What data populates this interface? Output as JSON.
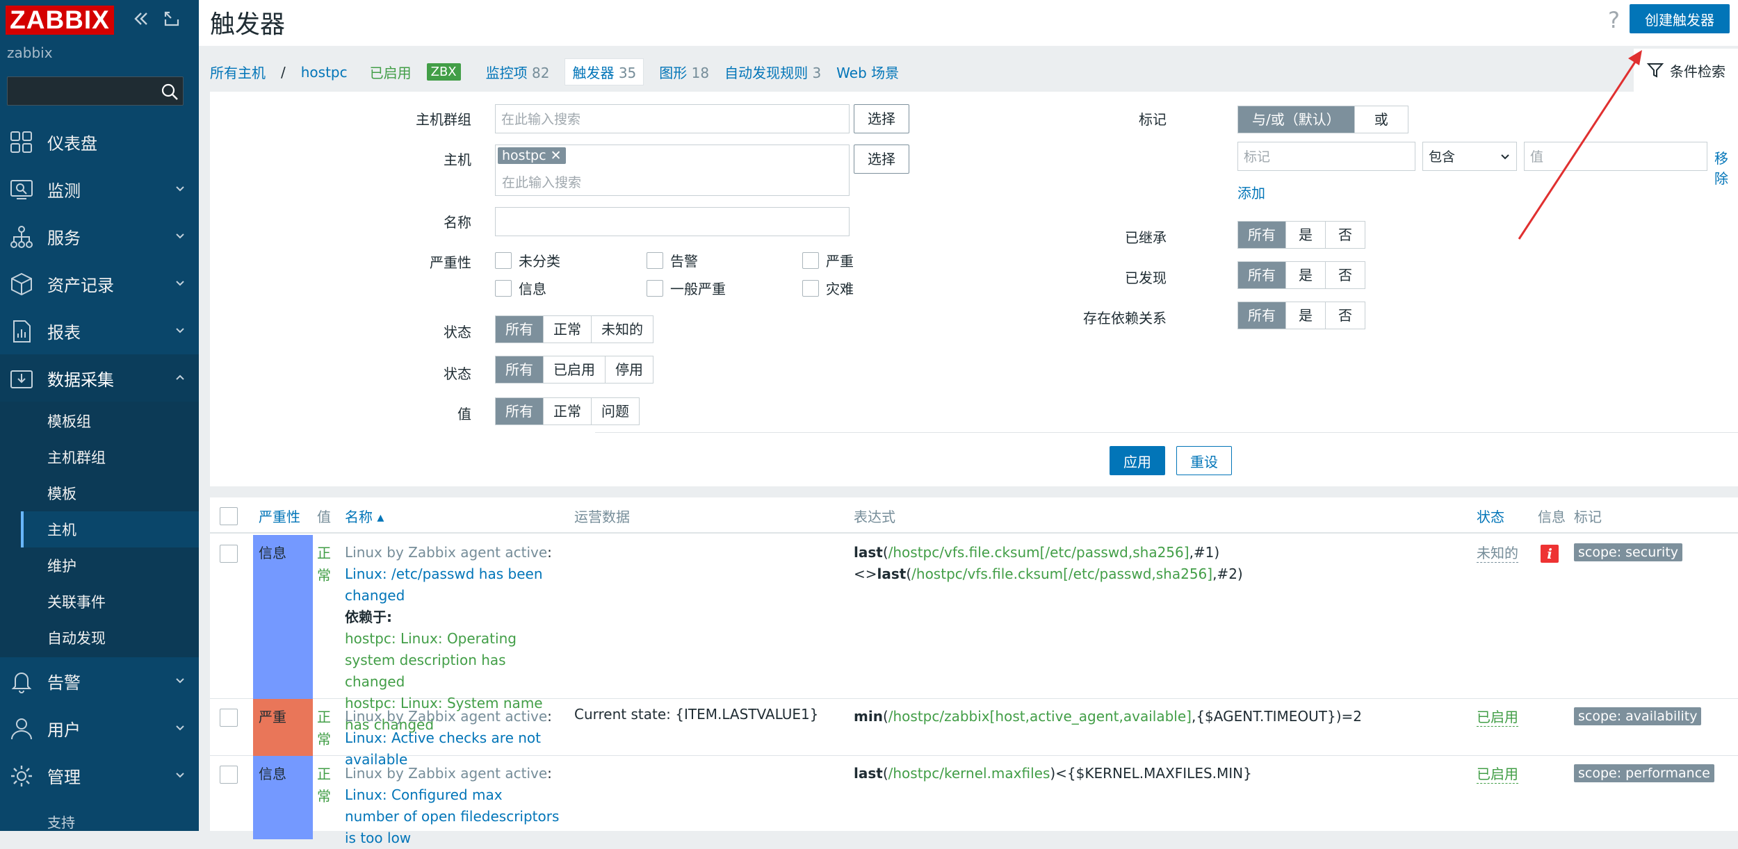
{
  "sidebar": {
    "logo": "ZABBIX",
    "subtitle": "zabbix",
    "search_placeholder": "",
    "menu": [
      {
        "label": "仪表盘",
        "icon": "dashboard-icon"
      },
      {
        "label": "监测",
        "icon": "monitoring-icon"
      },
      {
        "label": "服务",
        "icon": "services-icon"
      },
      {
        "label": "资产记录",
        "icon": "inventory-icon"
      },
      {
        "label": "报表",
        "icon": "reports-icon"
      },
      {
        "label": "数据采集",
        "icon": "data-collection-icon"
      },
      {
        "label": "告警",
        "icon": "alerts-icon"
      },
      {
        "label": "用户",
        "icon": "users-icon"
      },
      {
        "label": "管理",
        "icon": "admin-icon"
      }
    ],
    "submenu": [
      "模板组",
      "主机群组",
      "模板",
      "主机",
      "维护",
      "关联事件",
      "自动发现"
    ],
    "bottom_partial": "支持"
  },
  "header": {
    "title": "触发器",
    "help": "?",
    "create_button": "创建触发器"
  },
  "nav": {
    "all_hosts": "所有主机",
    "sep": "/",
    "host": "hostpc",
    "enabled": "已启用",
    "zbx": "ZBX",
    "items": "监控项",
    "items_count": "82",
    "triggers": "触发器",
    "triggers_count": "35",
    "graphs": "图形",
    "graphs_count": "18",
    "discovery": "自动发现规则",
    "discovery_count": "3",
    "web": "Web 场景",
    "filter_tab": "条件检索"
  },
  "filter": {
    "host_group_label": "主机群组",
    "host_group_placeholder": "在此输入搜索",
    "select": "选择",
    "host_label": "主机",
    "host_chip": "hostpc",
    "host_placeholder": "在此输入搜索",
    "name_label": "名称",
    "severity_label": "严重性",
    "severities": [
      "未分类",
      "告警",
      "严重",
      "信息",
      "一般严重",
      "灾难"
    ],
    "state_label": "状态",
    "state_opts": [
      "所有",
      "正常",
      "未知的"
    ],
    "status_label": "状态",
    "status_opts": [
      "所有",
      "已启用",
      "停用"
    ],
    "value_label": "值",
    "value_opts": [
      "所有",
      "正常",
      "问题"
    ],
    "tags_label": "标记",
    "tags_opts": [
      "与/或（默认）",
      "或"
    ],
    "tag_placeholder": "标记",
    "tag_op": "包含",
    "tag_value_placeholder": "值",
    "remove": "移除",
    "add": "添加",
    "inherited_label": "已继承",
    "discovered_label": "已发现",
    "depends_label": "存在依赖关系",
    "tri_opts": [
      "所有",
      "是",
      "否"
    ],
    "apply": "应用",
    "reset": "重设"
  },
  "table": {
    "headers": {
      "severity": "严重性",
      "value": "值",
      "name": "名称 ▴",
      "opdata": "运营数据",
      "expression": "表达式",
      "status": "状态",
      "info": "信息",
      "tags": "标记"
    },
    "rows": [
      {
        "severity": "信息",
        "sev_color": "#7499ff",
        "value": "正常",
        "template": "Linux by Zabbix agent active",
        "colon": ": ",
        "name": "Linux: /etc/passwd has been changed",
        "depends": "依赖于:",
        "dep1": "hostpc: Linux: Operating system description has changed",
        "dep2": "hostpc: Linux: System name has changed",
        "opdata": "",
        "ex1_fn": "last",
        "ex1_item": "/hostpc/vfs.file.cksum[/etc/passwd,sha256]",
        "ex1_tail": ",#1)",
        "ex2_pre": "<>",
        "ex2_fn": "last",
        "ex2_item": "/hostpc/vfs.file.cksum[/etc/passwd,sha256]",
        "ex2_tail": ",#2)",
        "status": "未知的",
        "info": "i",
        "tag": "scope: security"
      },
      {
        "severity": "严重",
        "sev_color": "#e97659",
        "value": "正常",
        "template": "Linux by Zabbix agent active",
        "colon": ": ",
        "name": "Linux: Active checks are not available",
        "opdata": "Current state: {ITEM.LASTVALUE1}",
        "ex1_fn": "min",
        "ex1_item": "/hostpc/zabbix[host,active_agent,available]",
        "ex1_tail": ",{$AGENT.TIMEOUT})=2",
        "status": "已启用",
        "tag": "scope: availability"
      },
      {
        "severity": "信息",
        "sev_color": "#7499ff",
        "value": "正常",
        "template": "Linux by Zabbix agent active",
        "colon": ": ",
        "name": "Linux: Configured max number of open filedescriptors is too low",
        "opdata": "",
        "ex1_fn": "last",
        "ex1_item": "/hostpc/kernel.maxfiles",
        "ex1_tail": ")<{$KERNEL.MAXFILES.MIN}",
        "status": "已启用",
        "tag": "scope: performance"
      }
    ]
  },
  "colors": {
    "brand": "#d40000",
    "sidebar": "#0a466a",
    "link": "#0275b8",
    "ok": "#429e47",
    "annotation": "#e03030"
  }
}
